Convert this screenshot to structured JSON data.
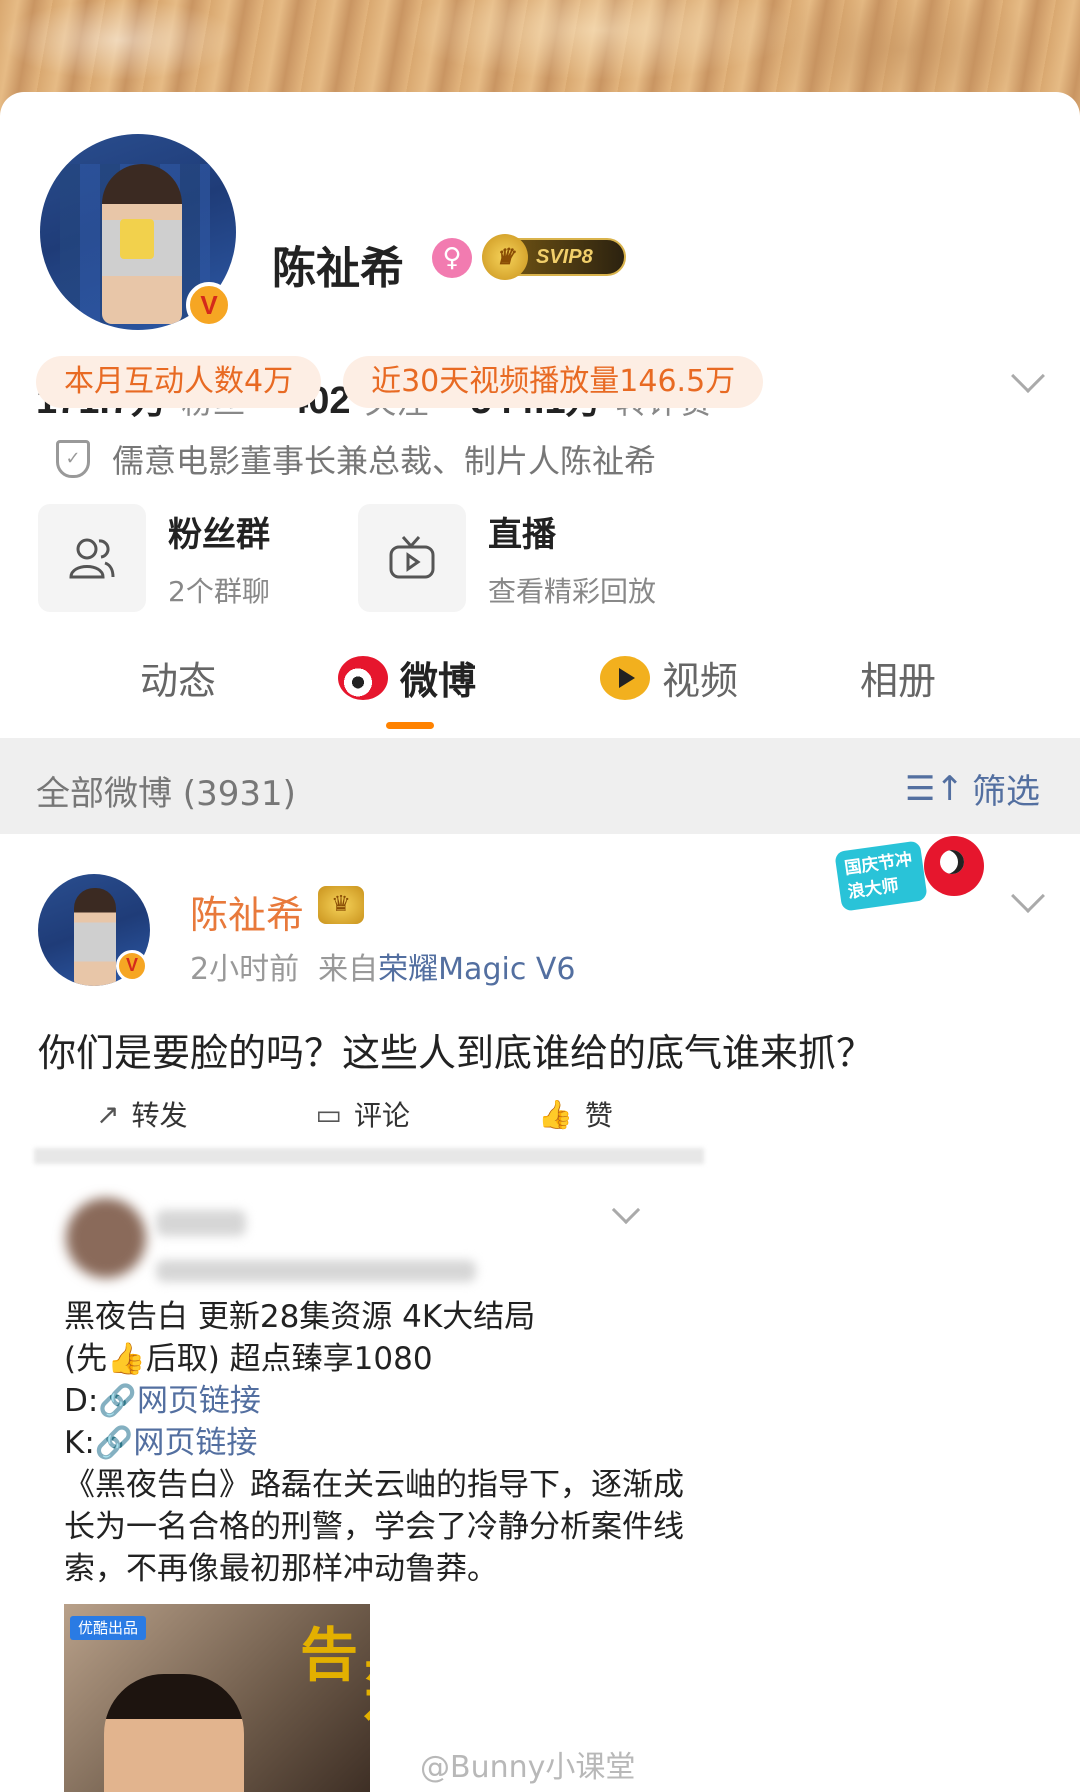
{
  "profile": {
    "name": "陈祉希",
    "vip_label": "SVIP8",
    "stats": [
      {
        "value": "171.7",
        "unit": "万",
        "label": "粉丝"
      },
      {
        "value": "402",
        "unit": "",
        "label": "关注"
      },
      {
        "value": "544.1",
        "unit": "万",
        "label": "转评赞"
      }
    ],
    "pills": [
      "本月互动人数4万",
      "近30天视频播放量146.5万"
    ],
    "verification": "儒意电影董事长兼总裁、制片人陈祉希",
    "tiles": [
      {
        "title": "粉丝群",
        "subtitle": "2个群聊",
        "icon": "group-icon"
      },
      {
        "title": "直播",
        "subtitle": "查看精彩回放",
        "icon": "tv-icon"
      }
    ]
  },
  "tabs": [
    "动态",
    "微博",
    "视频",
    "相册"
  ],
  "active_tab": "微博",
  "filter_bar": {
    "count_label": "全部微博 (3931)",
    "filter_label": "筛选"
  },
  "event_badge": {
    "text": "国庆节冲浪大师"
  },
  "post": {
    "author": "陈祉希",
    "time": "2小时前",
    "source_prefix": "来自",
    "device": "荣耀Magic V6",
    "text": "你们是要脸的吗？这些人到底谁给的底气谁来抓？",
    "actions": [
      "转发",
      "评论",
      "赞"
    ]
  },
  "embedded": {
    "line1": "黑夜告白  更新28集资源 4K大结局",
    "line2_a": "(先",
    "line2_b": "后取) 超点臻享1080",
    "d_prefix": "D:",
    "k_prefix": "K:",
    "link_text": "网页链接",
    "summary": "《黑夜告白》路磊在关云岫的指导下，逐渐成长为一名合格的刑警，学会了冷静分析案件线索，不再像最初那样冲动鲁莽。",
    "poster_tag": "优酷出品",
    "poster_title": "黑夜告"
  },
  "watermark": "@Bunny小课堂",
  "colors": {
    "accent": "#ff8200",
    "link": "#536fa0",
    "author": "#e8793b",
    "pill_text": "#e86a23"
  }
}
